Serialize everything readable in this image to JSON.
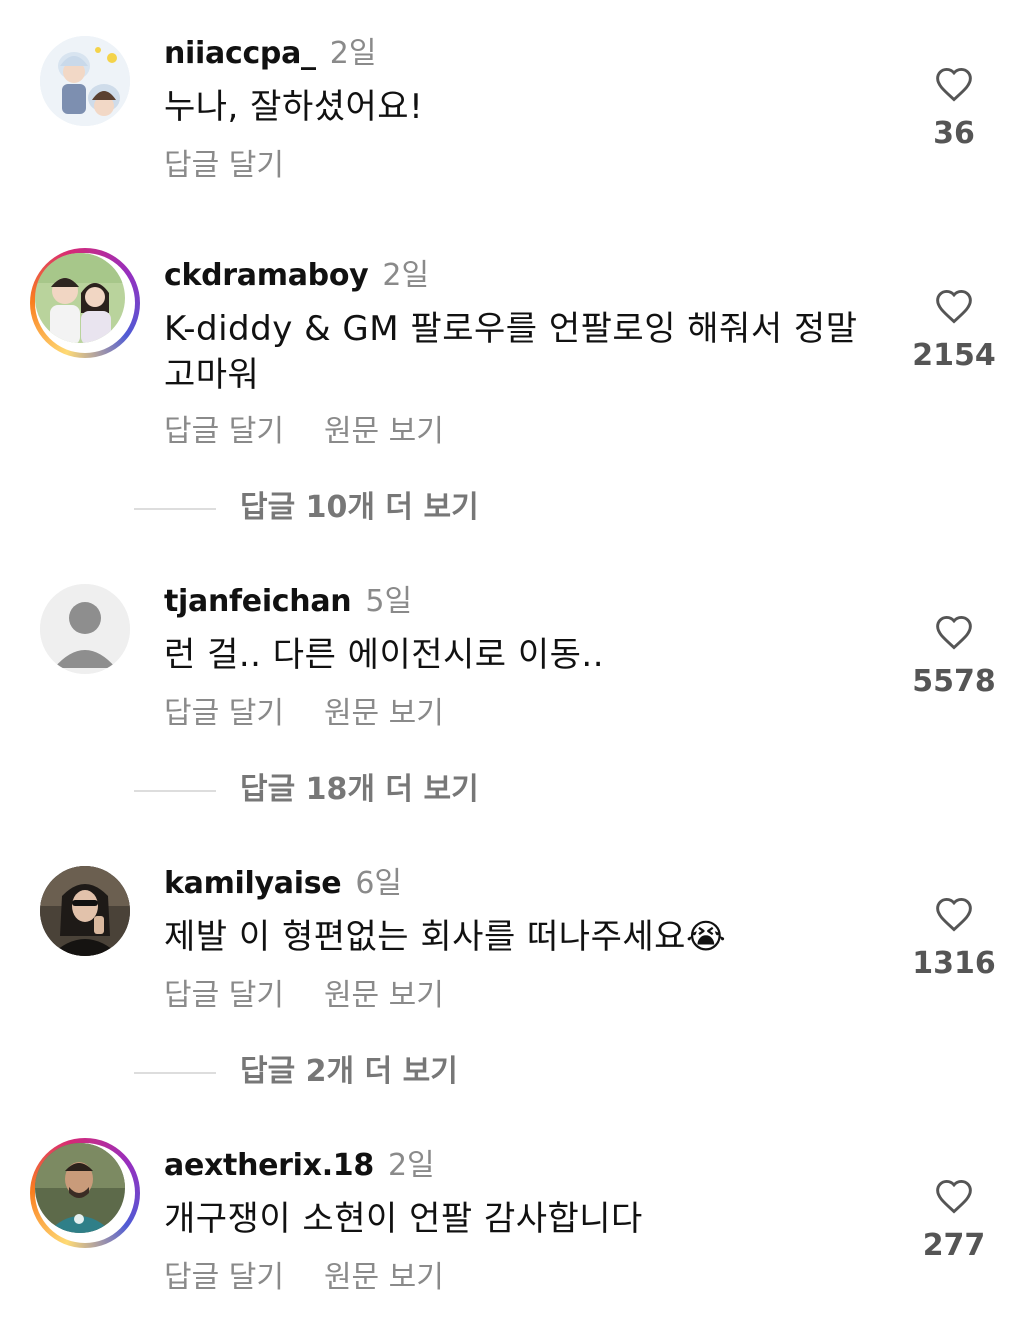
{
  "comments": [
    {
      "username": "niiaccpa_",
      "time": "2일",
      "text": "누나, 잘하셨어요!",
      "reply": "답글 달기",
      "see_original": "",
      "likes": "36",
      "more_replies": "",
      "story_ring": false
    },
    {
      "username": "ckdramaboy",
      "time": "2일",
      "text": "K-diddy & GM 팔로우를 언팔로잉 해줘서 정말 고마워",
      "reply": "답글 달기",
      "see_original": "원문 보기",
      "likes": "2154",
      "more_replies": "답글 10개 더 보기",
      "story_ring": true
    },
    {
      "username": "tjanfeichan",
      "time": "5일",
      "text": "런 걸.. 다른 에이전시로 이동..",
      "reply": "답글 달기",
      "see_original": "원문 보기",
      "likes": "5578",
      "more_replies": "답글 18개 더 보기",
      "story_ring": false
    },
    {
      "username": "kamilyaise",
      "time": "6일",
      "text": "제발 이 형편없는 회사를 떠나주세요",
      "emoji": "😭",
      "reply": "답글 달기",
      "see_original": "원문 보기",
      "likes": "1316",
      "more_replies": "답글 2개 더 보기",
      "story_ring": false
    },
    {
      "username": "aextherix.18",
      "time": "2일",
      "text": "개구쟁이 소현이 언팔 감사합니다",
      "reply": "답글 달기",
      "see_original": "원문 보기",
      "likes": "277",
      "more_replies": "",
      "story_ring": true
    }
  ],
  "icons": {
    "like": "heart-outline-icon",
    "default_avatar": "person-silhouette-icon"
  },
  "colors": {
    "secondary_text": "#8a8a8a",
    "story_ring_gradient": [
      "#feda75",
      "#fa7e1e",
      "#d62976",
      "#962fbf",
      "#4f5bd5"
    ]
  }
}
